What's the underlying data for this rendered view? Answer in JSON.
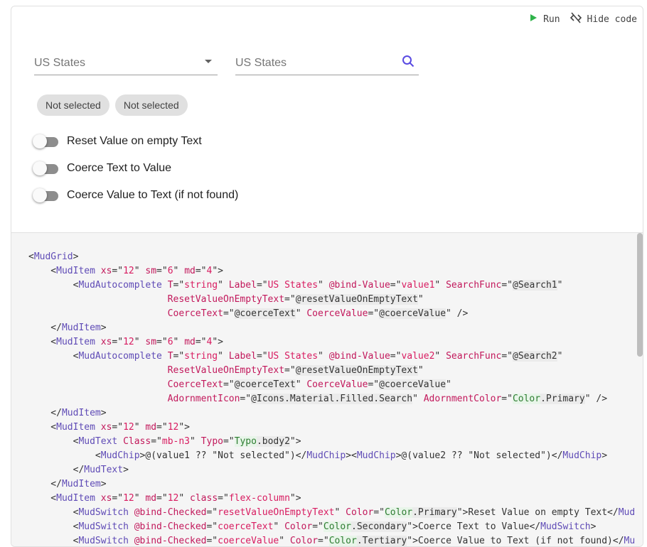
{
  "toolbar": {
    "run_label": "Run",
    "hide_code_label": "Hide code"
  },
  "fields": [
    {
      "label": "US States",
      "adornment_icon": "arrow-drop-down-icon"
    },
    {
      "label": "US States",
      "adornment_icon": "search-icon"
    }
  ],
  "chips": [
    "Not selected",
    "Not selected"
  ],
  "switches": [
    {
      "label": "Reset Value on empty Text",
      "checked": false
    },
    {
      "label": "Coerce Text to Value",
      "checked": false
    },
    {
      "label": "Coerce Value to Text (if not found)",
      "checked": false
    }
  ],
  "colors": {
    "run_icon": "#2fb34a",
    "search_icon": "#594ae2",
    "tag": "#5f4bb6",
    "attr": "#c2185b",
    "code_bg": "#f5f5f5"
  },
  "code": [
    "<MudGrid>",
    "    <MudItem xs=\"12\" sm=\"6\" md=\"4\">",
    "        <MudAutocomplete T=\"string\" Label=\"US States\" @bind-Value=\"value1\" SearchFunc=\"@Search1\"",
    "                         ResetValueOnEmptyText=\"@resetValueOnEmptyText\"",
    "                         CoerceText=\"@coerceText\" CoerceValue=\"@coerceValue\" />",
    "    </MudItem>",
    "    <MudItem xs=\"12\" sm=\"6\" md=\"4\">",
    "        <MudAutocomplete T=\"string\" Label=\"US States\" @bind-Value=\"value2\" SearchFunc=\"@Search2\"",
    "                         ResetValueOnEmptyText=\"@resetValueOnEmptyText\"",
    "                         CoerceText=\"@coerceText\" CoerceValue=\"@coerceValue\"",
    "                         AdornmentIcon=\"@Icons.Material.Filled.Search\" AdornmentColor=\"Color.Primary\" />",
    "    </MudItem>",
    "    <MudItem xs=\"12\" md=\"12\">",
    "        <MudText Class=\"mb-n3\" Typo=\"Typo.body2\">",
    "            <MudChip>@(value1 ?? \"Not selected\")</MudChip><MudChip>@(value2 ?? \"Not selected\")</MudChip>",
    "        </MudText>",
    "    </MudItem>",
    "    <MudItem xs=\"12\" md=\"12\" class=\"flex-column\">",
    "        <MudSwitch @bind-Checked=\"resetValueOnEmptyText\" Color=\"Color.Primary\">Reset Value on empty Text</Mud",
    "        <MudSwitch @bind-Checked=\"coerceText\" Color=\"Color.Secondary\">Coerce Text to Value</MudSwitch>",
    "        <MudSwitch @bind-Checked=\"coerceValue\" Color=\"Color.Tertiary\">Coerce Value to Text (if not found)</Mu"
  ]
}
